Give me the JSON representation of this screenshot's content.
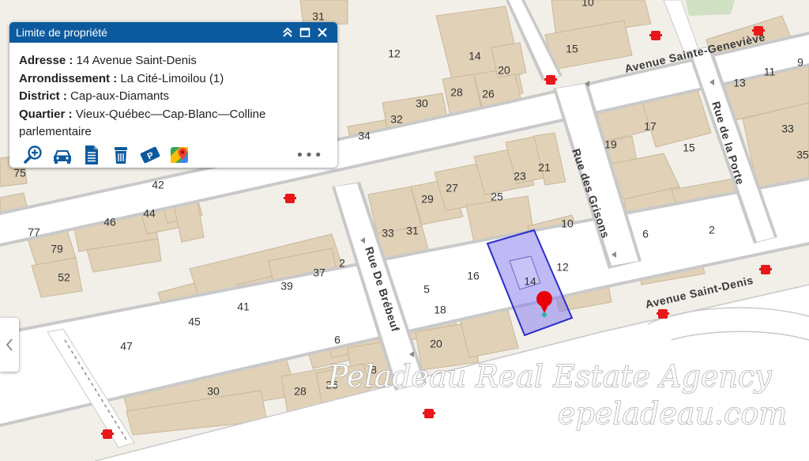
{
  "popup": {
    "title": "Limite de propriété",
    "fields": [
      {
        "label": "Adresse :",
        "value": "14 Avenue Saint-Denis"
      },
      {
        "label": "Arrondissement :",
        "value": "La Cité-Limoilou (1)"
      },
      {
        "label": "District :",
        "value": "Cap-aux-Diamants"
      },
      {
        "label": "Quartier :",
        "value": "Vieux-Québec—Cap-Blanc—Colline parlementaire"
      }
    ],
    "tools": [
      "zoom-in-icon",
      "car-icon",
      "document-icon",
      "trash-bin-icon",
      "parking-icon",
      "google-maps-icon"
    ],
    "more_label": "•••"
  },
  "streets": {
    "sainte_genevieve": "Avenue Sainte-Geneviève",
    "de_la_porte": "Rue de la Porte",
    "des_grisons": "Rue des Grisons",
    "de_brebeuf": "Rue De Brébeuf",
    "saint_denis": "Avenue Saint-Denis"
  },
  "numbers": {
    "n31": "31",
    "n12": "12",
    "n14": "14",
    "n20": "20",
    "n30": "30",
    "n28": "28",
    "n26": "26",
    "n32": "32",
    "n34": "34",
    "n10": "10",
    "n15": "15",
    "n13": "13",
    "n11": "11",
    "n9": "9",
    "n17": "17",
    "n19": "19",
    "n15b": "15",
    "n33": "33",
    "n35": "35",
    "n75": "75",
    "n42": "42",
    "n46": "46",
    "n44": "44",
    "n77": "77",
    "n79": "79",
    "n52": "52",
    "n29": "29",
    "n27": "27",
    "n25": "25",
    "n23": "23",
    "n21": "21",
    "n33b": "33",
    "n31b": "31",
    "n10b": "10",
    "n16": "16",
    "n14b": "14",
    "n12b": "12",
    "n5": "5",
    "n18": "18",
    "n20b": "20",
    "n6": "6",
    "n2": "2",
    "n39": "39",
    "n37": "37",
    "n2b": "2",
    "n41": "41",
    "n45": "45",
    "n6b": "6",
    "n47": "47",
    "n8": "8",
    "n30b": "30",
    "n28b": "28",
    "n26b": "26"
  },
  "watermark": {
    "line1": "Peladeau Real Estate Agency",
    "line2": "epeladeau.com"
  },
  "colors": {
    "building": "#e0d1b7",
    "road": "#ffffff",
    "selection_fill": "#8a80ee",
    "selection_stroke": "#2b2fc8",
    "marker": "#e8000b",
    "header": "#0c5a9e"
  }
}
